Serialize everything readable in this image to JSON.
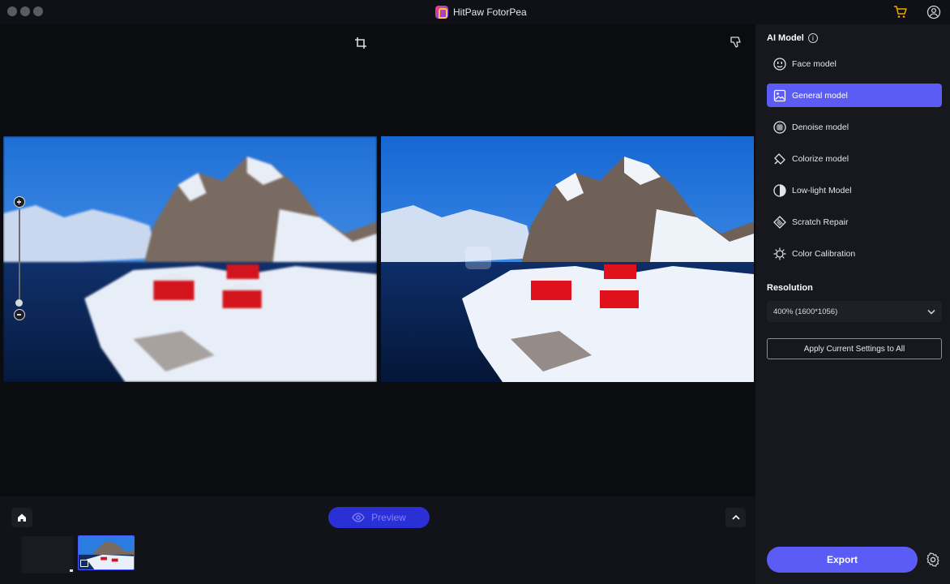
{
  "titlebar": {
    "app_title": "HitPaw FotorPea"
  },
  "canvas": {
    "preview_label": "Preview"
  },
  "panel": {
    "ai_model_title": "AI Model",
    "info_glyph": "i",
    "models": [
      {
        "label": "Face model",
        "icon": "face-icon",
        "active": false
      },
      {
        "label": "General model",
        "icon": "image-icon",
        "active": true
      },
      {
        "label": "Denoise model",
        "icon": "denoise-icon",
        "active": false
      },
      {
        "label": "Colorize model",
        "icon": "colorize-icon",
        "active": false
      },
      {
        "label": "Low-light Model",
        "icon": "lowlight-icon",
        "active": false
      },
      {
        "label": "Scratch Repair",
        "icon": "scratch-icon",
        "active": false
      },
      {
        "label": "Color Calibration",
        "icon": "calibration-icon",
        "active": false
      }
    ],
    "resolution_title": "Resolution",
    "resolution_value": "400% (1600*1056)",
    "apply_label": "Apply Current Settings to All",
    "export_label": "Export"
  },
  "colors": {
    "accent": "#5a5cf5",
    "preview_button": "#2a2fd6",
    "panel_bg": "#17181e",
    "cart": "#f0a500"
  }
}
